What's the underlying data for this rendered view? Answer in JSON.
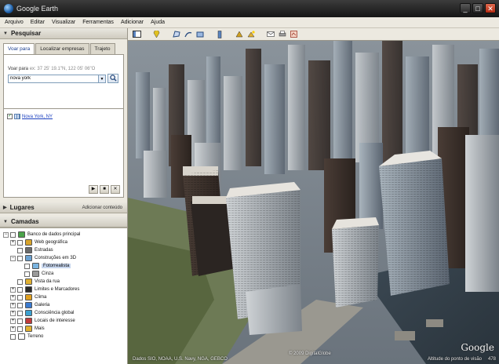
{
  "window": {
    "title": "Google Earth"
  },
  "menu": [
    "Arquivo",
    "Editar",
    "Visualizar",
    "Ferramentas",
    "Adicionar",
    "Ajuda"
  ],
  "search_panel": {
    "header": "Pesquisar",
    "tabs": [
      "Voar para",
      "Localizar empresas",
      "Trajeto"
    ],
    "fly_label": "Voar para",
    "fly_hint": "ex: 37 25' 19.1\"N, 122 05' 06\"O",
    "query": "nova york",
    "result": "Nova York, NY"
  },
  "places_panel": {
    "header": "Lugares",
    "add_content": "Adicionar conteúdo"
  },
  "layers_panel": {
    "header": "Camadas",
    "items": [
      {
        "label": "Banco de dados principal",
        "level": 0,
        "expander": "−",
        "icon_color": "#4aa34a"
      },
      {
        "label": "Web geográfica",
        "level": 1,
        "expander": "+",
        "icon_color": "#d9a42a"
      },
      {
        "label": "Estradas",
        "level": 1,
        "expander": "",
        "icon_color": "#6a6a6a"
      },
      {
        "label": "Construções em 3D",
        "level": 1,
        "expander": "−",
        "icon_color": "#6aa0d0"
      },
      {
        "label": "Fotorrealista",
        "level": 2,
        "expander": "",
        "icon_color": "#7ab4e0",
        "selected": true
      },
      {
        "label": "Cinza",
        "level": 2,
        "expander": "",
        "icon_color": "#9a9a9a"
      },
      {
        "label": "Vista da rua",
        "level": 1,
        "expander": "",
        "icon_color": "#e0b030"
      },
      {
        "label": "Limites e Marcadores",
        "level": 1,
        "expander": "+",
        "icon_color": "#2a2a2a"
      },
      {
        "label": "Clima",
        "level": 1,
        "expander": "+",
        "icon_color": "#e0a020"
      },
      {
        "label": "Galeria",
        "level": 1,
        "expander": "+",
        "icon_color": "#3a7ad0"
      },
      {
        "label": "Consciência global",
        "level": 1,
        "expander": "+",
        "icon_color": "#3aa0d0"
      },
      {
        "label": "Locais de interesse",
        "level": 1,
        "expander": "+",
        "icon_color": "#c03a3a"
      },
      {
        "label": "Mais",
        "level": 1,
        "expander": "+",
        "icon_color": "#e0b030"
      },
      {
        "label": "Terreno",
        "level": 0,
        "expander": "",
        "icon_color": "#ffffff"
      }
    ]
  },
  "toolbar_icons": [
    "sidebar-toggle-icon",
    "placemark-icon",
    "polygon-icon",
    "path-icon",
    "overlay-icon",
    "tour-icon",
    "history-icon",
    "sun-icon",
    "planet-icon",
    "ruler-icon",
    "email-icon",
    "print-icon",
    "maps-icon"
  ],
  "viewport": {
    "logo": "Google",
    "copyright": "© 2009 DigitalGlobe",
    "altitude": "Altitude do ponto de visão",
    "altitude_value": "478",
    "left_attrib": "Dados SIO, NOAA, U.S. Navy, NGA, GEBCO"
  }
}
